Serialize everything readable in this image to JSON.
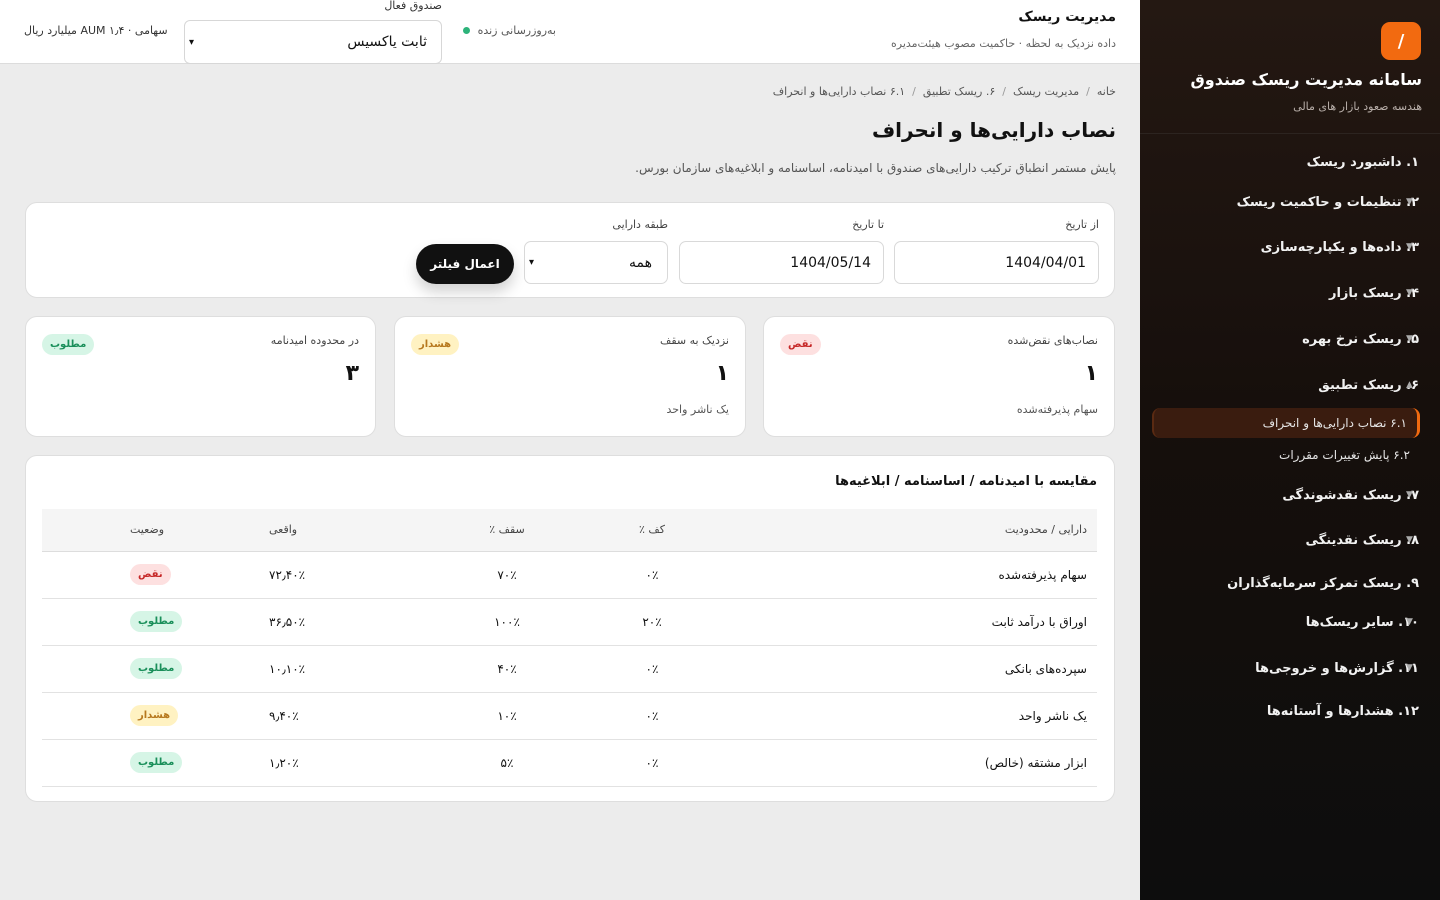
{
  "sidebar": {
    "logo": "/",
    "title": "سامانه مدیریت ریسک صندوق",
    "subtitle": "هندسه صعود بازار های مالی",
    "items": [
      {
        "label": "۱. داشبورد ریسک",
        "chev": ""
      },
      {
        "label": "۲. تنظیمات و حاکمیت ریسک",
        "chev": "▼"
      },
      {
        "label": "۳. داده‌ها و یکپارچه‌سازی",
        "chev": "▼"
      },
      {
        "label": "۴. ریسک بازار",
        "chev": "▼"
      },
      {
        "label": "۵. ریسک نرخ بهره",
        "chev": "▼"
      },
      {
        "label": "۶. ریسک تطبیق",
        "chev": "▲"
      },
      {
        "label": "۷. ریسک نقدشوندگی",
        "chev": "▼"
      },
      {
        "label": "۸. ریسک نقدینگی",
        "chev": "▼"
      },
      {
        "label": "۹. ریسک تمرکز سرمایه‌گذاران",
        "chev": ""
      },
      {
        "label": "۱۰. سایر ریسک‌ها",
        "chev": "▼"
      },
      {
        "label": "۱۱. گزارش‌ها و خروجی‌ها",
        "chev": "▼"
      },
      {
        "label": "۱۲. هشدارها و آستانه‌ها",
        "chev": ""
      }
    ],
    "subitems": [
      {
        "label": "۶.۱ نصاب دارایی‌ها و انحراف"
      },
      {
        "label": "۶.۲ پایش تغییرات مقررات"
      }
    ]
  },
  "topbar": {
    "title": "مدیریت ریسک",
    "subtitle": "داده نزدیک به لحظه · حاکمیت مصوب هیئت‌مدیره",
    "live": "به‌روزرسانی زنده",
    "fund_label": "صندوق فعال",
    "fund_value": "ثابت یاکسیس",
    "aum": "سهامی · AUM ۱٫۴ میلیارد ریال"
  },
  "breadcrumb": [
    "خانه",
    "مدیریت ریسک",
    "۶. ریسک تطبیق",
    "۶.۱ نصاب دارایی‌ها و انحراف"
  ],
  "page": {
    "title": "نصاب دارایی‌ها و انحراف",
    "description": "پایش مستمر انطباق ترکیب دارایی‌های صندوق با امیدنامه، اساسنامه و ابلاغیه‌های سازمان بورس."
  },
  "filters": {
    "from_label": "از تاریخ",
    "from_value": "1404/04/01",
    "to_label": "تا تاریخ",
    "to_value": "1404/05/14",
    "class_label": "طبقه دارایی",
    "class_value": "همه",
    "apply_label": "اعمال فیلتر"
  },
  "stats": [
    {
      "label": "نصاب‌های نقض‌شده",
      "value": "۱",
      "foot": "سهام پذیرفته‌شده",
      "badge": "نقض"
    },
    {
      "label": "نزدیک به سقف",
      "value": "۱",
      "foot": "یک ناشر واحد",
      "badge": "هشدار"
    },
    {
      "label": "در محدوده امیدنامه",
      "value": "۳",
      "foot": "",
      "badge": "مطلوب"
    }
  ],
  "table": {
    "title": "مقایسه با امیدنامه / اساسنامه / ابلاغیه‌ها",
    "headers": [
      "دارایی / محدودیت",
      "کف ٪",
      "سقف ٪",
      "واقعی",
      "وضعیت"
    ],
    "rows": [
      {
        "asset": "سهام پذیرفته‌شده",
        "floor": "۰٪",
        "cap": "۷۰٪",
        "actual": "۷۲٫۴۰٪",
        "status": "نقض"
      },
      {
        "asset": "اوراق با درآمد ثابت",
        "floor": "۲۰٪",
        "cap": "۱۰۰٪",
        "actual": "۳۶٫۵۰٪",
        "status": "مطلوب"
      },
      {
        "asset": "سپرده‌های بانکی",
        "floor": "۰٪",
        "cap": "۴۰٪",
        "actual": "۱۰٫۱۰٪",
        "status": "مطلوب"
      },
      {
        "asset": "یک ناشر واحد",
        "floor": "۰٪",
        "cap": "۱۰٪",
        "actual": "۹٫۴۰٪",
        "status": "هشدار"
      },
      {
        "asset": "ابزار مشتقه (خالص)",
        "floor": "۰٪",
        "cap": "۵٪",
        "actual": "۱٫۲۰٪",
        "status": "مطلوب"
      }
    ]
  },
  "colors": {
    "accent": "#f26a10",
    "danger": "#c62828",
    "warning": "#b7791f",
    "success": "#1a8f5a",
    "live": "#2db37a"
  }
}
